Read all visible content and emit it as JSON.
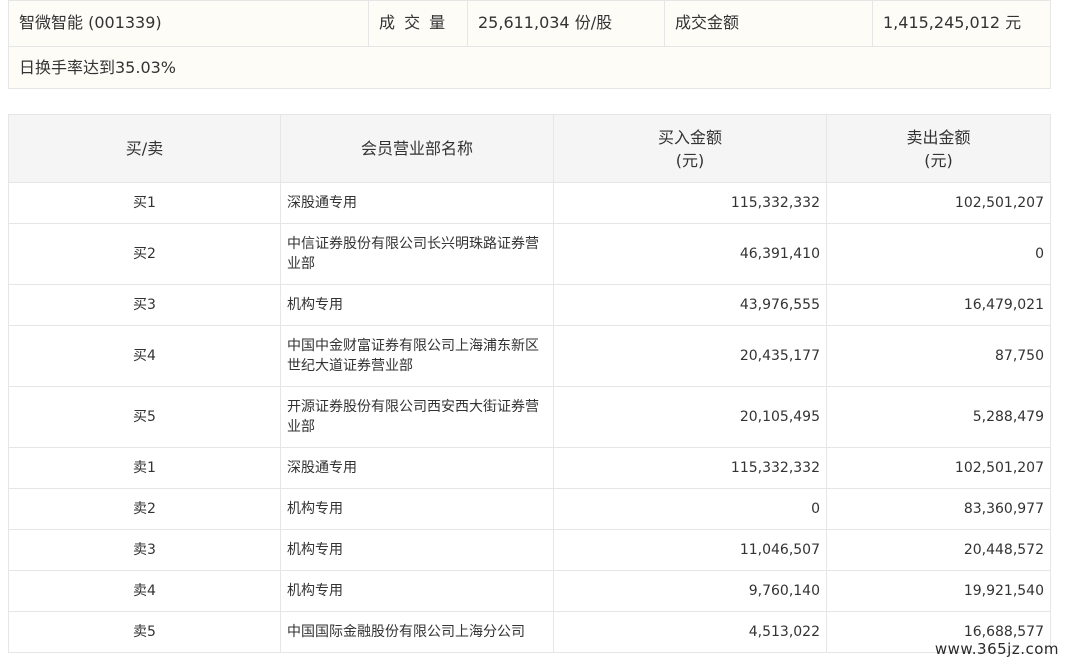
{
  "summary": {
    "stock": "智微智能 (001339)",
    "volume_label": "成 交 量",
    "volume_value": "25,611,034 份/股",
    "amount_label": "成交金额",
    "amount_value": "1,415,245,012 元",
    "turnover_note": "日换手率达到35.03%"
  },
  "table": {
    "headers": {
      "side": "买/卖",
      "name": "会员营业部名称",
      "buy_line1": "买入金额",
      "buy_line2": "(元)",
      "sell_line1": "卖出金额",
      "sell_line2": "(元)"
    },
    "rows": [
      {
        "side": "买1",
        "name": "深股通专用",
        "buy": "115,332,332",
        "sell": "102,501,207"
      },
      {
        "side": "买2",
        "name": "中信证券股份有限公司长兴明珠路证券营业部",
        "buy": "46,391,410",
        "sell": "0"
      },
      {
        "side": "买3",
        "name": "机构专用",
        "buy": "43,976,555",
        "sell": "16,479,021"
      },
      {
        "side": "买4",
        "name": "中国中金财富证券有限公司上海浦东新区世纪大道证券营业部",
        "buy": "20,435,177",
        "sell": "87,750"
      },
      {
        "side": "买5",
        "name": "开源证券股份有限公司西安西大街证券营业部",
        "buy": "20,105,495",
        "sell": "5,288,479"
      },
      {
        "side": "卖1",
        "name": "深股通专用",
        "buy": "115,332,332",
        "sell": "102,501,207"
      },
      {
        "side": "卖2",
        "name": "机构专用",
        "buy": "0",
        "sell": "83,360,977"
      },
      {
        "side": "卖3",
        "name": "机构专用",
        "buy": "11,046,507",
        "sell": "20,448,572"
      },
      {
        "side": "卖4",
        "name": "机构专用",
        "buy": "9,760,140",
        "sell": "19,921,540"
      },
      {
        "side": "卖5",
        "name": "中国国际金融股份有限公司上海分公司",
        "buy": "4,513,022",
        "sell": "16,688,577"
      }
    ]
  },
  "watermark": "www.365jz.com"
}
